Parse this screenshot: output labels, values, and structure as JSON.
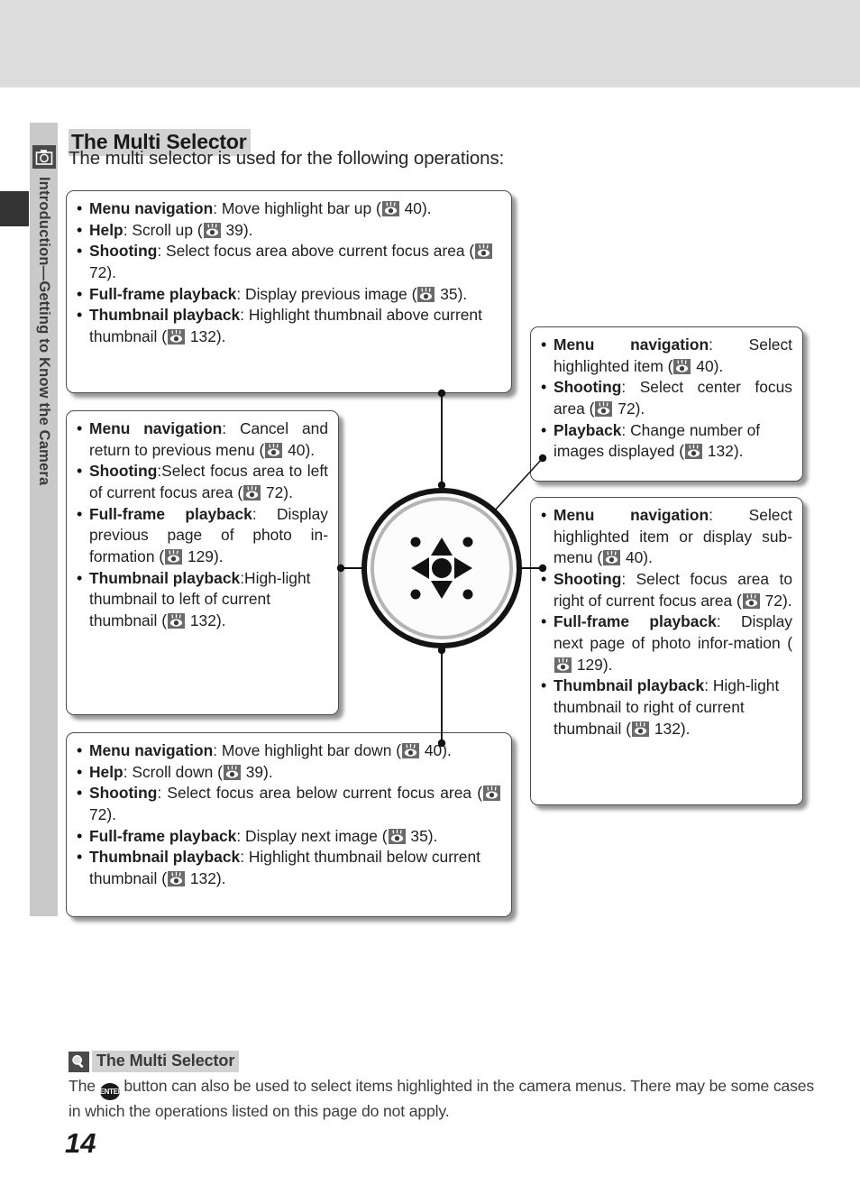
{
  "page": {
    "number": "14",
    "title": "The Multi Selector",
    "lede": "The multi selector is used for the following operations:"
  },
  "sidebar": {
    "label": "Introduction—Getting to Know the Camera",
    "icon": "camera-icon"
  },
  "pref_icon_name": "page-reference-eye-icon",
  "callouts": {
    "up": {
      "direction": "up",
      "items": [
        {
          "term": "Menu navigation",
          "sep": ": ",
          "text": "Move highlight bar up (",
          "page": "40",
          "tail": ")."
        },
        {
          "term": "Help",
          "sep": ": ",
          "text": "Scroll up (",
          "page": "39",
          "tail": ")."
        },
        {
          "term": "Shooting",
          "sep": ": ",
          "text": "Select focus area above current focus area (",
          "page": "72",
          "tail": ")."
        },
        {
          "term": "Full-frame playback",
          "sep": ": ",
          "text": "Display previous image (",
          "page": "35",
          "tail": ")."
        },
        {
          "term": "Thumbnail playback",
          "sep": ": ",
          "text": "Highlight thumbnail above current thumbnail (",
          "page": "132",
          "tail": ")."
        }
      ]
    },
    "left": {
      "direction": "left",
      "items": [
        {
          "term": "Menu navigation",
          "sep": ": ",
          "text": "Cancel and return to previous menu (",
          "page": "40",
          "tail": ")."
        },
        {
          "term": "Shooting",
          "sep": ":",
          "text": "Select focus area to left of current focus area (",
          "page": "72",
          "tail": ")."
        },
        {
          "term": "Full-frame playback",
          "sep": ": ",
          "text": "Display previous page of photo in-formation (",
          "page": "129",
          "tail": ")."
        },
        {
          "term": "Thumbnail playback",
          "sep": ":",
          "text": "High-light thumbnail to left of current thumbnail (",
          "page": "132",
          "tail": ")."
        }
      ]
    },
    "down": {
      "direction": "down",
      "items": [
        {
          "term": "Menu navigation",
          "sep": ": ",
          "text": "Move highlight bar down (",
          "page": "40",
          "tail": ")."
        },
        {
          "term": "Help",
          "sep": ": ",
          "text": "Scroll down (",
          "page": "39",
          "tail": ")."
        },
        {
          "term": "Shooting",
          "sep": ": ",
          "text": "Select focus area below current focus area (",
          "page": "72",
          "tail": ")."
        },
        {
          "term": "Full-frame playback",
          "sep": ": ",
          "text": "Display next image (",
          "page": "35",
          "tail": ")."
        },
        {
          "term": "Thumbnail playback",
          "sep": ": ",
          "text": "Highlight thumbnail below current thumbnail (",
          "page": "132",
          "tail": ")."
        }
      ]
    },
    "center": {
      "direction": "center",
      "items": [
        {
          "term": "Menu navigation",
          "sep": ": ",
          "text": "Select highlighted item (",
          "page": "40",
          "tail": ")."
        },
        {
          "term": "Shooting",
          "sep": ": ",
          "text": "Select center focus area (",
          "page": "72",
          "tail": ")."
        },
        {
          "term": "Playback",
          "sep": ": ",
          "text": "Change number of images displayed (",
          "page": "132",
          "tail": ")."
        }
      ]
    },
    "right": {
      "direction": "right",
      "items": [
        {
          "term": "Menu navigation",
          "sep": ": ",
          "text": "Select highlighted item or display sub-menu (",
          "page": "40",
          "tail": ")."
        },
        {
          "term": "Shooting",
          "sep": ": ",
          "text": "Select focus area to right of current focus area (",
          "page": "72",
          "tail": ")."
        },
        {
          "term": "Full-frame playback",
          "sep": ": ",
          "text": "Display next page of photo infor-mation (",
          "page": "129",
          "tail": ")."
        },
        {
          "term": "Thumbnail playback",
          "sep": ": ",
          "text": "High-light thumbnail to right of current thumbnail (",
          "page": "132",
          "tail": ")."
        }
      ]
    }
  },
  "note": {
    "icon": "magnifier-icon",
    "title": "The Multi Selector",
    "before_button": "The ",
    "button_label": "ENTER",
    "after_button": " button can also be used to select items highlighted in the camera menus.  There may be some cases in which the operations listed on this page do not apply."
  },
  "colors": {
    "top_band": "#dcdcdc",
    "sidebar_strip": "#c9c9c9",
    "sidebar_tab_dark": "#333333",
    "title_highlight": "#d2d2d2",
    "pref_icon_bg": "#6a6a6a",
    "box_border": "#4d4d4d"
  }
}
